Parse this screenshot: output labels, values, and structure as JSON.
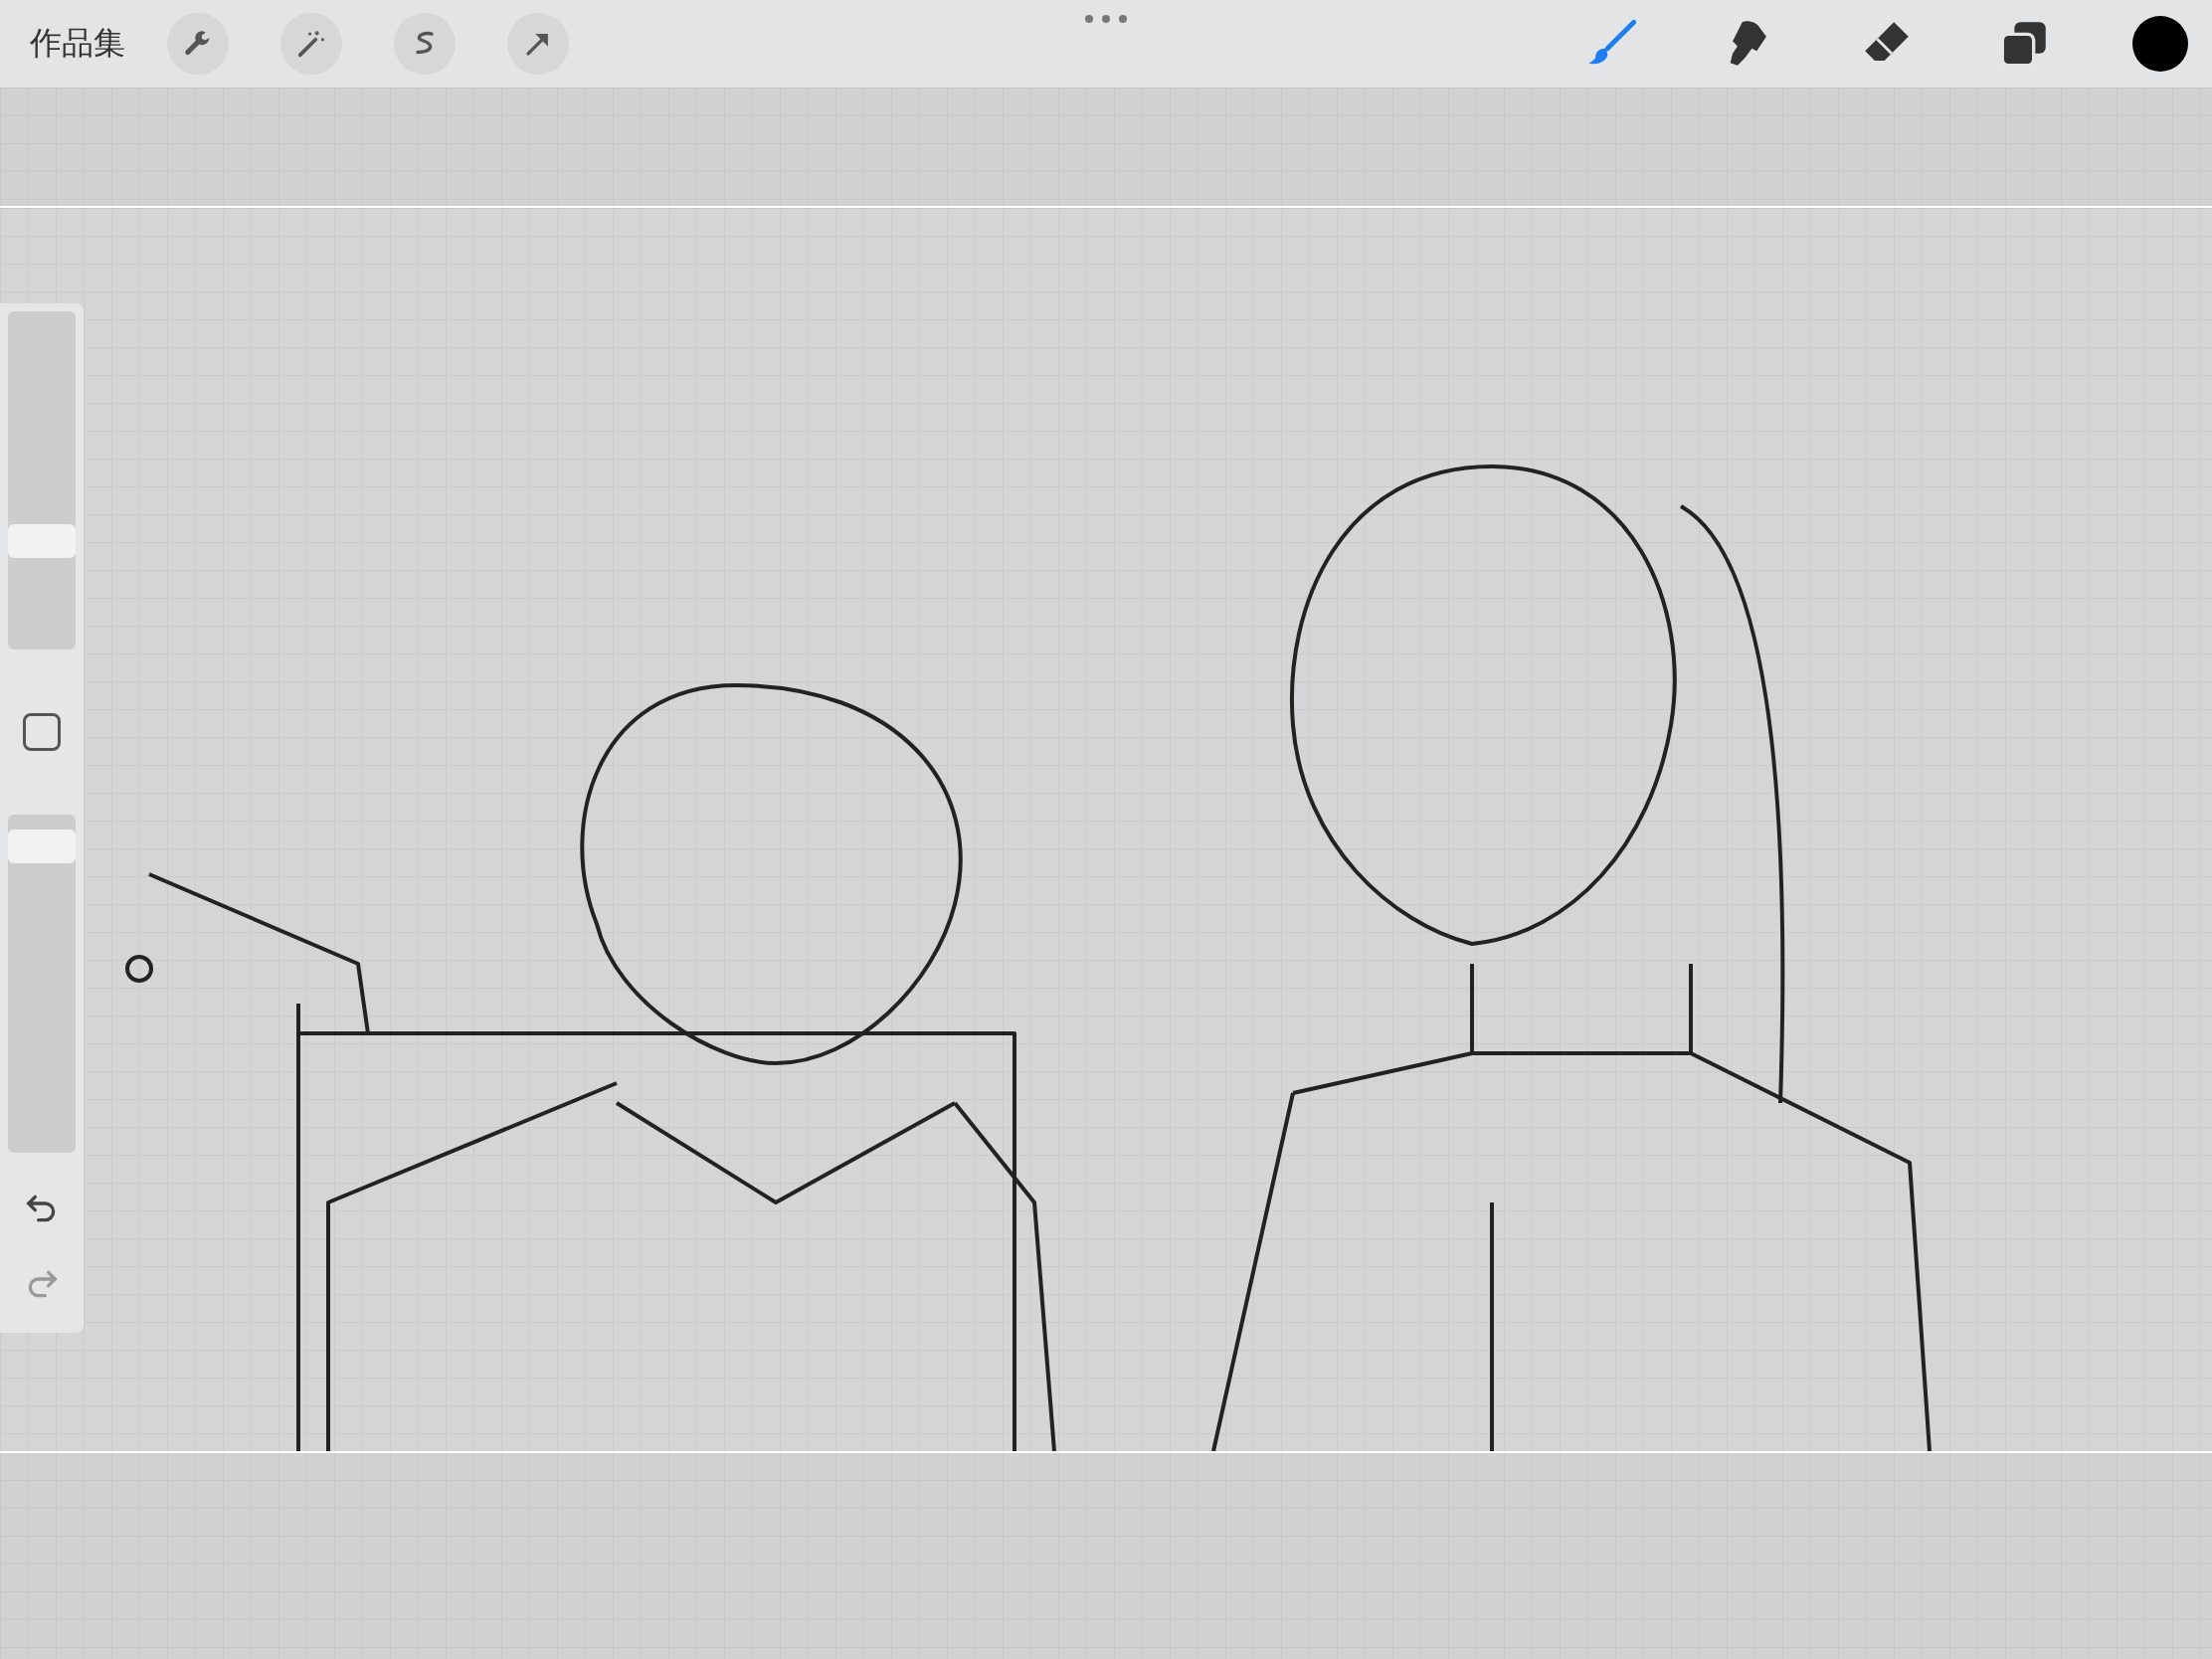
{
  "top_bar": {
    "gallery_label": "作品集",
    "left_tools": [
      {
        "kind": "wrench",
        "selected": false
      },
      {
        "kind": "wand",
        "selected": false
      },
      {
        "kind": "selection",
        "selected": false
      },
      {
        "kind": "transform",
        "selected": false
      }
    ],
    "right_tools": [
      {
        "kind": "brush",
        "selected": true
      },
      {
        "kind": "smudge",
        "selected": false
      },
      {
        "kind": "eraser",
        "selected": false
      },
      {
        "kind": "layers",
        "selected": false
      }
    ],
    "current_color": {
      "color": "#000000"
    }
  },
  "sidebar": {
    "brush_size": {
      "level": 0.3
    },
    "opacity": {
      "level": 0.95
    }
  }
}
